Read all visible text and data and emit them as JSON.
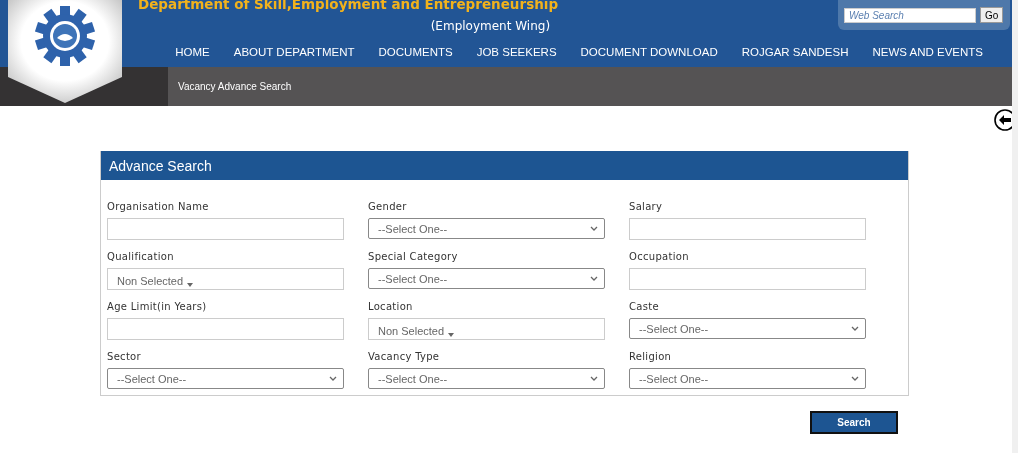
{
  "header": {
    "title": "Department of Skill,Employment and Entrepreneurship",
    "subtitle": "(Employment Wing)",
    "search": {
      "placeholder": "Web Search",
      "button": "Go"
    },
    "nav": [
      "HOME",
      "ABOUT DEPARTMENT",
      "DOCUMENTS",
      "JOB SEEKERS",
      "DOCUMENT DOWNLOAD",
      "ROJGAR SANDESH",
      "NEWS AND EVENTS"
    ]
  },
  "breadcrumb": "Vacancy Advance Search",
  "panel": {
    "title": "Advance Search",
    "fields": [
      {
        "label": "Organisation Name",
        "kind": "text"
      },
      {
        "label": "Gender",
        "kind": "select",
        "value": "--Select One--"
      },
      {
        "label": "Salary",
        "kind": "text"
      },
      {
        "label": "Qualification",
        "kind": "multiselect",
        "value": "Non Selected"
      },
      {
        "label": "Special Category",
        "kind": "select",
        "value": "--Select One--"
      },
      {
        "label": "Occupation",
        "kind": "text"
      },
      {
        "label": "Age Limit(in Years)",
        "kind": "text"
      },
      {
        "label": "Location",
        "kind": "multiselect",
        "value": "Non Selected"
      },
      {
        "label": "Caste",
        "kind": "select",
        "value": "--Select One--"
      },
      {
        "label": "Sector",
        "kind": "select",
        "value": "--Select One--"
      },
      {
        "label": "Vacancy Type",
        "kind": "select",
        "value": "--Select One--"
      },
      {
        "label": "Religion",
        "kind": "select",
        "value": "--Select One--"
      }
    ]
  },
  "search_button": "Search"
}
